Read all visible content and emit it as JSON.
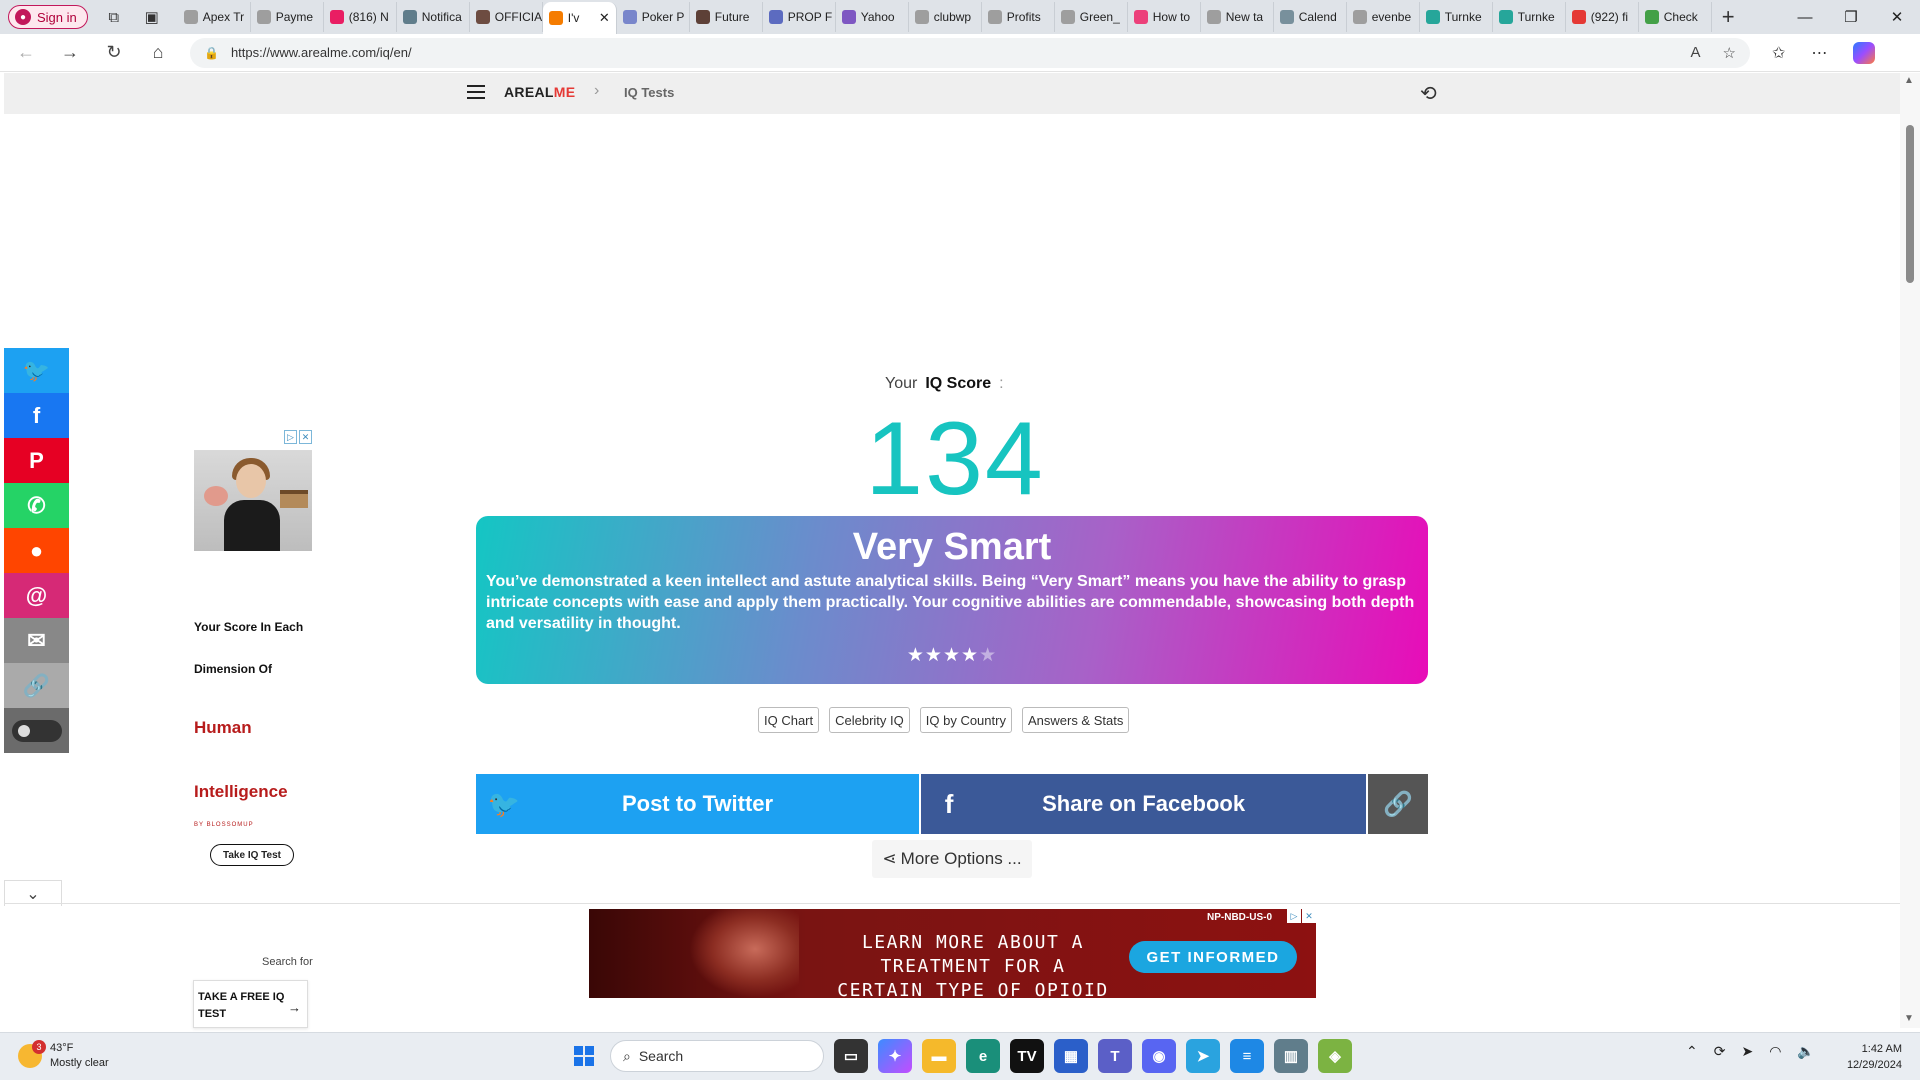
{
  "browser": {
    "signin_label": "Sign in",
    "tabs": [
      {
        "label": "Apex Tr",
        "color": "#9e9e9e"
      },
      {
        "label": "Payme",
        "color": "#9e9e9e"
      },
      {
        "label": "(816) N",
        "color": "#e91e63"
      },
      {
        "label": "Notifica",
        "color": "#607d8b"
      },
      {
        "label": "OFFICIA",
        "color": "#6d4c41"
      },
      {
        "label": "I'v",
        "color": "#f57c00",
        "active": true
      },
      {
        "label": "Poker P",
        "color": "#7986cb"
      },
      {
        "label": "Future",
        "color": "#5d4037"
      },
      {
        "label": "PROP F",
        "color": "#5c6bc0"
      },
      {
        "label": "Yahoo",
        "color": "#7e57c2"
      },
      {
        "label": "clubwp",
        "color": "#9e9e9e"
      },
      {
        "label": "Profits",
        "color": "#9e9e9e"
      },
      {
        "label": "Green_",
        "color": "#9e9e9e"
      },
      {
        "label": "How to",
        "color": "#ec407a"
      },
      {
        "label": "New ta",
        "color": "#9e9e9e"
      },
      {
        "label": "Calend",
        "color": "#78909c"
      },
      {
        "label": "evenbe",
        "color": "#9e9e9e"
      },
      {
        "label": "Turnke",
        "color": "#26a69a"
      },
      {
        "label": "Turnke",
        "color": "#26a69a"
      },
      {
        "label": "(922) fi",
        "color": "#e53935"
      },
      {
        "label": "Check",
        "color": "#43a047"
      }
    ],
    "active_tab_close": "✕",
    "new_tab": "+",
    "url": "https://www.arealme.com/iq/en/"
  },
  "site": {
    "logo_main": "AREAL",
    "logo_accent": "ME",
    "breadcrumb_sep": "›",
    "breadcrumb": "IQ Tests"
  },
  "sidebar_share": [
    {
      "name": "twitter",
      "color": "#1da1f2",
      "glyph": "🐦"
    },
    {
      "name": "facebook",
      "color": "#1877f2",
      "glyph": "f"
    },
    {
      "name": "pinterest",
      "color": "#e60023",
      "glyph": "P"
    },
    {
      "name": "whatsapp",
      "color": "#25d366",
      "glyph": "✆"
    },
    {
      "name": "reddit",
      "color": "#ff4500",
      "glyph": "●"
    },
    {
      "name": "threads",
      "color": "#d62976",
      "glyph": "@"
    },
    {
      "name": "email",
      "color": "#888888",
      "glyph": "✉"
    },
    {
      "name": "copy-link",
      "color": "#aaaaaa",
      "glyph": "🔗"
    }
  ],
  "side_ad": {
    "line1": "Your Score In Each",
    "line2": "Dimension Of",
    "red1": "Human",
    "red2": "Intelligence",
    "brand": "BY BLOSSOMUP",
    "cta": "Take IQ Test"
  },
  "result": {
    "label_prefix": "Your",
    "label_bold": "IQ Score",
    "label_colon": ":",
    "score": "134",
    "title": "Very Smart",
    "description": "You’ve demonstrated a keen intellect and astute analytical skills. Being “Very Smart” means you have the ability to grasp intricate concepts with ease and apply them practically. Your cognitive abilities are commendable, showcasing both depth and versatility in thought.",
    "stars_filled": 4,
    "stars_total": 5
  },
  "quick_links": [
    "IQ Chart",
    "Celebrity IQ",
    "IQ by Country",
    "Answers & Stats"
  ],
  "share": {
    "twitter_label": "Post to Twitter",
    "facebook_label": "Share on Facebook",
    "more_label": "More Options ..."
  },
  "bottom_left": {
    "search_for": "Search for",
    "card_text": "TAKE A FREE IQ TEST"
  },
  "banner": {
    "headline_line1": "LEARN MORE ABOUT A TREATMENT FOR A",
    "headline_line2": "CERTAIN TYPE OF OPIOID ADDICTION",
    "cta": "GET INFORMED",
    "tag": "NP-NBD-US-0"
  },
  "taskbar": {
    "weather_temp": "43°F",
    "weather_desc": "Mostly clear",
    "weather_badge": "3",
    "search_placeholder": "Search",
    "time": "1:42 AM",
    "date": "12/29/2024"
  }
}
